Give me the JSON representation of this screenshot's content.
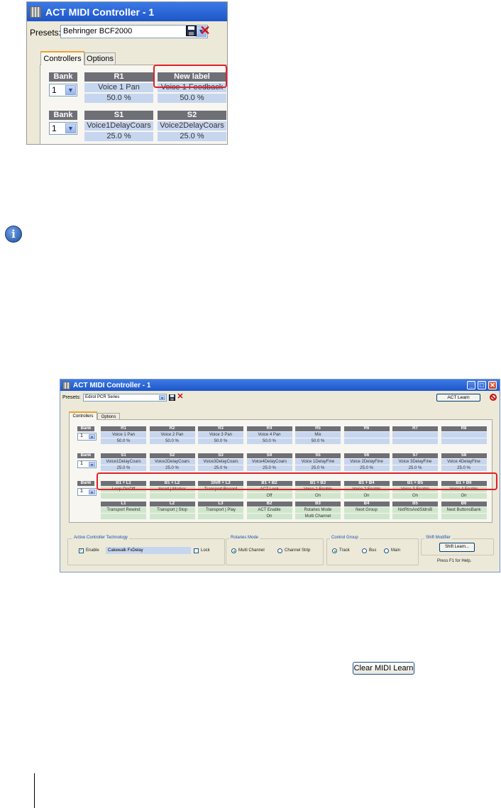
{
  "screenshot1": {
    "title": "ACT MIDI Controller - 1",
    "presets_label": "Presets:",
    "preset_value": "Behringer BCF2000",
    "tabs": [
      "Controllers",
      "Options"
    ],
    "bank_label": "Bank",
    "rows": [
      {
        "bank_value": "1",
        "controls": [
          {
            "label": "R1",
            "param": "Voice 1 Pan",
            "value": "50.0 %"
          },
          {
            "label": "New label",
            "param": "Voice 1 Feedback",
            "value": "50.0 %"
          }
        ]
      },
      {
        "bank_value": "1",
        "controls": [
          {
            "label": "S1",
            "param": "Voice1DelayCoars",
            "value": "25.0 %"
          },
          {
            "label": "S2",
            "param": "Voice2DelayCoars",
            "value": "25.0 %"
          }
        ]
      }
    ]
  },
  "screenshot2": {
    "title": "ACT MIDI Controller - 1",
    "presets_label": "Presets:",
    "preset_value": "Edirol PCR Series",
    "act_learn": "ACT Learn",
    "tabs": [
      "Controllers",
      "Options"
    ],
    "bank_label": "Bank",
    "bank_values": [
      "1",
      "1",
      "1"
    ],
    "rotaries": [
      {
        "label": "R1",
        "param": "Voice 1 Pan",
        "value": "50.0 %"
      },
      {
        "label": "R2",
        "param": "Voice 2 Pan",
        "value": "50.0 %"
      },
      {
        "label": "R3",
        "param": "Voice 3 Pan",
        "value": "50.0 %"
      },
      {
        "label": "R4",
        "param": "Voice 4 Pan",
        "value": "50.0 %"
      },
      {
        "label": "R5",
        "param": "Mix",
        "value": "50.0 %"
      },
      {
        "label": "R6",
        "param": "",
        "value": ""
      },
      {
        "label": "R7",
        "param": "",
        "value": ""
      },
      {
        "label": "R8",
        "param": "",
        "value": ""
      }
    ],
    "sliders": [
      {
        "label": "S1",
        "param": "Voice1DelayCoars",
        "value": "25.0 %"
      },
      {
        "label": "S2",
        "param": "Voice2DelayCoars",
        "value": "25.0 %"
      },
      {
        "label": "S3",
        "param": "Voice3DelayCoars",
        "value": "25.0 %"
      },
      {
        "label": "S4",
        "param": "Voice4DelayCoars",
        "value": "25.0 %"
      },
      {
        "label": "S5",
        "param": "Voice 1DelayFine",
        "value": "25.0 %"
      },
      {
        "label": "S6",
        "param": "Voice 2DelayFine",
        "value": "25.0 %"
      },
      {
        "label": "S7",
        "param": "Voice 3DelayFine",
        "value": "25.0 %"
      },
      {
        "label": "S8",
        "param": "Voice 4DelayFine",
        "value": "25.0 %"
      }
    ],
    "shift_buttons": [
      {
        "label": "B1 + L1",
        "param": "Loop On/Off",
        "value": ""
      },
      {
        "label": "B1 + L2",
        "param": "Insert | Marker",
        "value": ""
      },
      {
        "label": "Shift + L3",
        "param": "Transport Record",
        "value": ""
      },
      {
        "label": "B1 + B2",
        "param": "ACT Lock",
        "value": "Off"
      },
      {
        "label": "B1 + B3",
        "param": "Voice 1 Enable",
        "value": "On"
      },
      {
        "label": "B1 + B4",
        "param": "Voice 2 Enable",
        "value": "On"
      },
      {
        "label": "B1 + B5",
        "param": "Voice 3 Enable",
        "value": "On"
      },
      {
        "label": "B1 + B6",
        "param": "Voice 4 Enable",
        "value": "On"
      }
    ],
    "buttons": [
      {
        "label": "L1",
        "param": "Transport Rewind",
        "value": ""
      },
      {
        "label": "L2",
        "param": "Transport | Stop",
        "value": ""
      },
      {
        "label": "L3",
        "param": "Transport | Play",
        "value": ""
      },
      {
        "label": "B2",
        "param": "ACT Enable",
        "value": "On"
      },
      {
        "label": "B3",
        "param": "Rotaries Mode",
        "value": "Multi Channel"
      },
      {
        "label": "B4",
        "param": "Next Group",
        "value": ""
      },
      {
        "label": "B5",
        "param": "NxtRtrsAndSldrsB",
        "value": ""
      },
      {
        "label": "B6",
        "param": "Next ButtonsBank",
        "value": ""
      }
    ],
    "act_group": {
      "title": "Active Controller Technology",
      "enable_label": "Enable",
      "plugin": "Cakewalk FxDelay",
      "lock_label": "Lock"
    },
    "rotaries_mode": {
      "title": "Rotaries Mode",
      "multi": "Multi Channel",
      "strip": "Channel Strip"
    },
    "control_group": {
      "title": "Control Group",
      "track": "Track",
      "bus": "Bus",
      "main": "Main"
    },
    "shift_modifier": {
      "title": "Shift Modifier",
      "button": "Shift Learn...",
      "help": "Press F1 for Help."
    }
  },
  "clear_midi_learn": "Clear MIDI Learn",
  "colors": {
    "header": "#6f6f78",
    "value_blue": "#c7d6ef",
    "value_green": "#cfe6cc",
    "highlight": "#e0202a",
    "titlebar": "#2a62d6"
  },
  "icons": [
    "app-icon",
    "combo-arrow-icon",
    "save-icon",
    "delete-icon",
    "info-icon",
    "no-entry-icon",
    "minimize-icon",
    "maximize-icon",
    "close-icon"
  ]
}
